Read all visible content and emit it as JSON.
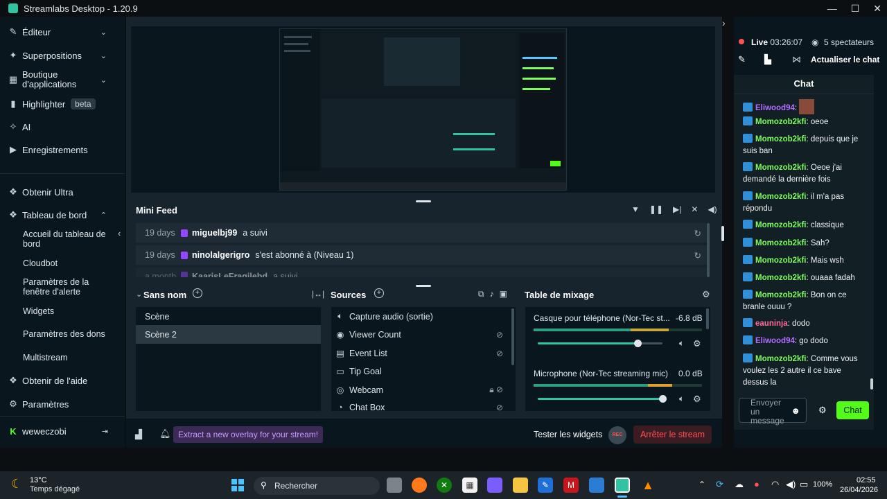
{
  "app": {
    "title": "Streamlabs Desktop - 1.20.9"
  },
  "window": {
    "minimize": "—",
    "maximize": "☐",
    "close": "✕"
  },
  "sidebar": {
    "items": [
      {
        "label": "Éditeur",
        "icon": "pencil-icon",
        "expandable": true
      },
      {
        "label": "Superpositions",
        "icon": "overlays-icon",
        "expandable": true
      },
      {
        "label": "Boutique d'applications",
        "icon": "store-icon",
        "expandable": true
      },
      {
        "label": "Highlighter",
        "icon": "highlighter-icon",
        "badge": "beta"
      },
      {
        "label": "AI",
        "icon": "sparkle-icon"
      },
      {
        "label": "Enregistrements",
        "icon": "record-icon"
      },
      {
        "label": "Obtenir Ultra",
        "icon": "ultra-icon"
      },
      {
        "label": "Tableau de bord",
        "icon": "dashboard-icon",
        "expanded": true
      }
    ],
    "dashboard_sub": [
      "Accueil du tableau de bord",
      "Cloudbot",
      "Paramètres de la fenêtre d'alerte",
      "Widgets",
      "Paramètres des dons",
      "Multistream"
    ],
    "bottom": [
      {
        "label": "Obtenir de l'aide",
        "icon": "help-icon"
      },
      {
        "label": "Paramètres",
        "icon": "gear-icon"
      }
    ],
    "user": "weweczobi"
  },
  "minifeed": {
    "title": "Mini Feed",
    "rows": [
      {
        "date": "19 days",
        "name": "miguelbj99",
        "action": "a suivi"
      },
      {
        "date": "19 days",
        "name": "ninolalgerigro",
        "action": "s'est abonné à (Niveau 1)"
      },
      {
        "date": "a month",
        "name": "KaarisLeFragilebd",
        "action": "a suivi"
      }
    ]
  },
  "scenes": {
    "title": "Sans nom",
    "items": [
      "Scène",
      "Scène 2"
    ]
  },
  "sources": {
    "title": "Sources",
    "items": [
      {
        "label": "Capture audio (sortie)",
        "icon": "speaker-icon"
      },
      {
        "label": "Viewer Count",
        "icon": "eye-icon"
      },
      {
        "label": "Event List",
        "icon": "list-icon"
      },
      {
        "label": "Tip Goal",
        "icon": "widget-icon"
      },
      {
        "label": "Webcam",
        "icon": "webcam-icon"
      },
      {
        "label": "Chat Box",
        "icon": "chat-icon"
      }
    ]
  },
  "mixer": {
    "title": "Table de mixage",
    "channels": [
      {
        "name": "Casque pour téléphone (Nor-Tec st...",
        "db": "-6.8 dB",
        "level": 0.8
      },
      {
        "name": "Microphone (Nor-Tec streaming mic)",
        "db": "0.0 dB",
        "level": 1.0
      }
    ]
  },
  "footer": {
    "promo": "Extract a new overlay for your stream!",
    "test_widgets": "Tester les widgets",
    "rec": "REC",
    "stop_stream": "Arrêter le stream"
  },
  "live": {
    "status": "Live",
    "time": "03:26:07",
    "viewers": "5 spectateurs",
    "refresh_chat": "Actualiser le chat"
  },
  "chat": {
    "title": "Chat",
    "messages": [
      {
        "user": "Eliwood94",
        "text": "",
        "color": "#b26cff"
      },
      {
        "user": "Momozob2kfi",
        "text": "oeoe",
        "color": "#7cff5a"
      },
      {
        "user": "Momozob2kfi",
        "text": "depuis que je suis ban",
        "color": "#7cff5a"
      },
      {
        "user": "Momozob2kfi",
        "text": "Oeoe j'ai demandé la dernière fois",
        "color": "#7cff5a"
      },
      {
        "user": "Momozob2kfi",
        "text": "il m'a pas répondu",
        "color": "#7cff5a"
      },
      {
        "user": "Momozob2kfi",
        "text": "classique",
        "color": "#7cff5a"
      },
      {
        "user": "Momozob2kfi",
        "text": "Sah?",
        "color": "#7cff5a"
      },
      {
        "user": "Momozob2kfi",
        "text": "Mais wsh",
        "color": "#7cff5a"
      },
      {
        "user": "Momozob2kfi",
        "text": "ouaaa fadah",
        "color": "#7cff5a"
      },
      {
        "user": "Momozob2kfi",
        "text": "Bon on ce branle ouuu ?",
        "color": "#7cff5a"
      },
      {
        "user": "eauninja",
        "text": "dodo",
        "color": "#ff6b9a"
      },
      {
        "user": "Eliwood94",
        "text": "go dodo",
        "color": "#b26cff"
      },
      {
        "user": "Momozob2kfi",
        "text": "Comme vous voulez les 2 autre il ce bave dessus la",
        "color": "#7cff5a"
      }
    ],
    "placeholder": "Envoyer un message",
    "send": "Chat"
  },
  "taskbar": {
    "temp": "13°C",
    "weather": "Temps dégagé",
    "search": "Rechercher",
    "battery": "100%",
    "time": "02:55",
    "date": "26/04/2026"
  },
  "colors": {
    "accent": "#31c3a2",
    "twitch": "#9146ff",
    "live": "#ff5353",
    "stop": "#ff5353"
  }
}
